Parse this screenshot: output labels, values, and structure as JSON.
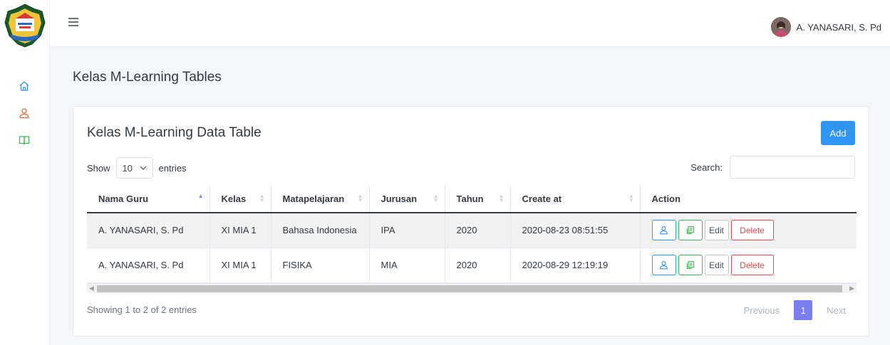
{
  "app": {
    "user_name": "A. YANASARI, S. Pd"
  },
  "page": {
    "title": "Kelas M-Learning Tables"
  },
  "card": {
    "title": "Kelas M-Learning Data Table",
    "add_label": "Add",
    "show_label": "Show",
    "entries_value": "10",
    "entries_label": "entries",
    "search_label": "Search:",
    "search_value": ""
  },
  "table": {
    "headers": [
      "Nama Guru",
      "Kelas",
      "Matapelajaran",
      "Jurusan",
      "Tahun",
      "Create at",
      "Action"
    ],
    "rows": [
      [
        "A. YANASARI, S. Pd",
        "XI MIA 1",
        "Bahasa Indonesia",
        "IPA",
        "2020",
        "2020-08-23 08:51:55"
      ],
      [
        "A. YANASARI, S. Pd",
        "XI MIA 1",
        "FISIKA",
        "MIA",
        "2020",
        "2020-08-29 12:19:19"
      ]
    ],
    "action_edit": "Edit",
    "action_delete": "Delete"
  },
  "footer": {
    "info": "Showing 1 to 2 of 2 entries",
    "previous": "Previous",
    "current_page": "1",
    "next": "Next"
  },
  "icons": {
    "sidebar": [
      "home-icon",
      "user-icon",
      "book-icon"
    ],
    "actions": [
      "user-icon",
      "copy-icon"
    ]
  },
  "colors": {
    "primary": "#2f96f3",
    "success": "#46b654",
    "danger": "#e8484b",
    "pagination_active": "#7a7ef0",
    "sidebar_home": "#2f96f3",
    "sidebar_user": "#f26b3a",
    "sidebar_book": "#46b654"
  }
}
